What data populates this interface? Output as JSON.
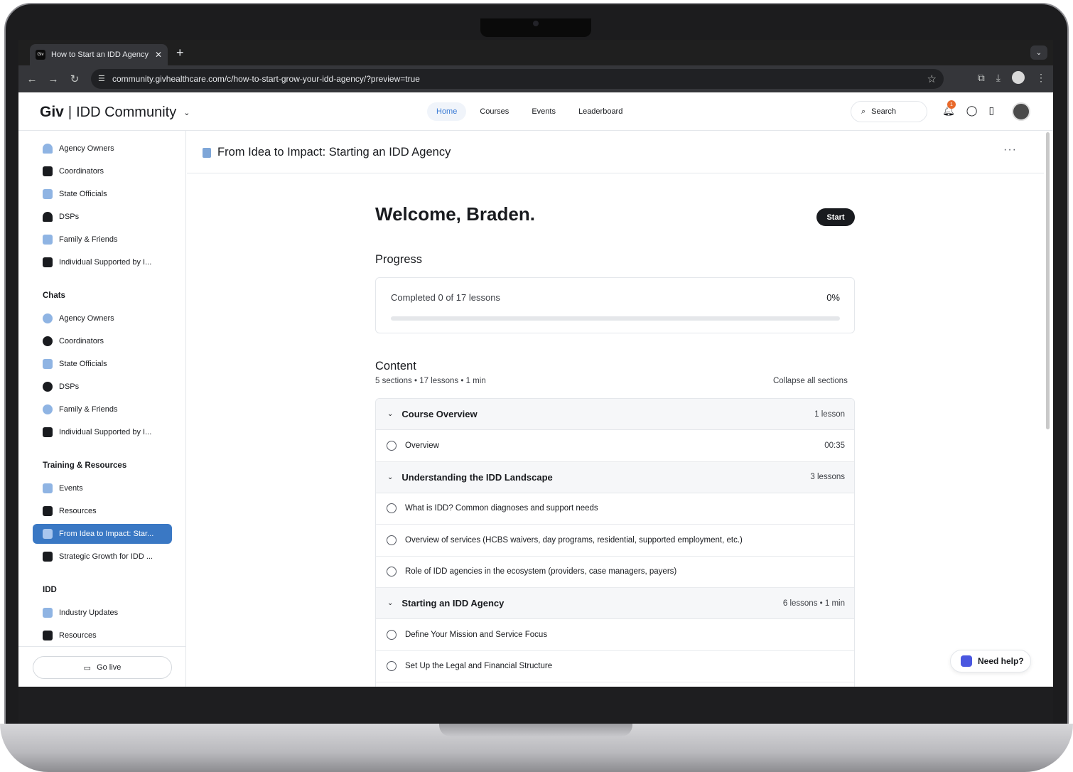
{
  "browser": {
    "tab_title": "How to Start an IDD Agency |",
    "tab_favicon_text": "Giv",
    "url": "community.givhealthcare.com/c/how-to-start-grow-your-idd-agency/?preview=true"
  },
  "header": {
    "brand_short": "Giv",
    "brand_sep": "|",
    "brand_name": "IDD Community",
    "nav": [
      "Home",
      "Courses",
      "Events",
      "Leaderboard"
    ],
    "active_nav": "Home",
    "search_label": "Search",
    "notification_count": "1"
  },
  "sidebar": {
    "spaces": [
      {
        "label": "Agency Owners",
        "color": "#8fb4e3"
      },
      {
        "label": "Coordinators",
        "color": "#191b1f"
      },
      {
        "label": "State Officials",
        "color": "#8fb4e3"
      },
      {
        "label": "DSPs",
        "color": "#191b1f"
      },
      {
        "label": "Family & Friends",
        "color": "#8fb4e3"
      },
      {
        "label": "Individual Supported by I...",
        "color": "#191b1f"
      }
    ],
    "chats_heading": "Chats",
    "chats": [
      {
        "label": "Agency Owners",
        "color": "#8fb4e3"
      },
      {
        "label": "Coordinators",
        "color": "#191b1f"
      },
      {
        "label": "State Officials",
        "color": "#8fb4e3"
      },
      {
        "label": "DSPs",
        "color": "#191b1f"
      },
      {
        "label": "Family & Friends",
        "color": "#8fb4e3"
      },
      {
        "label": "Individual Supported by I...",
        "color": "#191b1f"
      }
    ],
    "training_heading": "Training & Resources",
    "training": [
      {
        "label": "Events",
        "color": "#8fb4e3"
      },
      {
        "label": "Resources",
        "color": "#191b1f"
      },
      {
        "label": "From Idea to Impact: Star...",
        "color": "#a9c6ee",
        "active": true
      },
      {
        "label": "Strategic Growth for IDD ...",
        "color": "#191b1f"
      }
    ],
    "idd_heading": "IDD",
    "idd": [
      {
        "label": "Industry Updates",
        "color": "#8fb4e3"
      },
      {
        "label": "Resources",
        "color": "#191b1f"
      }
    ],
    "go_live_label": "Go live"
  },
  "main": {
    "space_title": "From Idea to Impact: Starting an IDD Agency",
    "more_label": "···",
    "welcome": "Welcome, Braden.",
    "start_label": "Start",
    "progress_heading": "Progress",
    "progress_text": "Completed 0 of 17 lessons",
    "progress_percent": "0%",
    "progress_fraction": 0,
    "content_heading": "Content",
    "content_meta": "5 sections • 17 lessons • 1 min",
    "collapse_label": "Collapse all sections",
    "sections": [
      {
        "title": "Course Overview",
        "count": "1 lesson",
        "lessons": [
          {
            "title": "Overview",
            "duration": "00:35"
          }
        ]
      },
      {
        "title": "Understanding the IDD Landscape",
        "count": "3 lessons",
        "lessons": [
          {
            "title": "What is IDD? Common diagnoses and support needs",
            "duration": ""
          },
          {
            "title": "Overview of services (HCBS waivers, day programs, residential, supported employment, etc.)",
            "duration": ""
          },
          {
            "title": "Role of IDD agencies in the ecosystem (providers, case managers, payers)",
            "duration": ""
          }
        ]
      },
      {
        "title": "Starting an IDD Agency",
        "count": "6 lessons • 1 min",
        "lessons": [
          {
            "title": "Define Your Mission and Service Focus",
            "duration": ""
          },
          {
            "title": "Set Up the Legal and Financial Structure",
            "duration": ""
          }
        ]
      }
    ],
    "help_label": "Need help?"
  }
}
